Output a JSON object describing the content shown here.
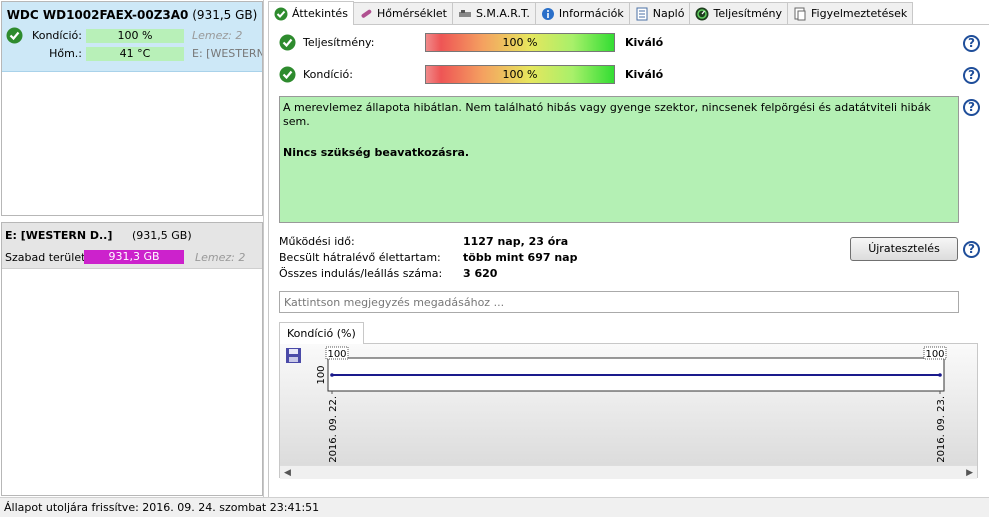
{
  "disk": {
    "model": "WDC WD1002FAEX-00Z3A0",
    "capacity": "(931,5 GB)",
    "condition_label": "Kondíció:",
    "condition_value": "100 %",
    "condition_extra": "Lemez: 2",
    "temp_label": "Hőm.:",
    "temp_value": "41 °C",
    "temp_extra": "E: [WESTERN"
  },
  "volume": {
    "name": "E: [WESTERN D..]",
    "size": "(931,5 GB)",
    "free_label": "Szabad terület",
    "free_value": "931,3 GB",
    "disk_label": "Lemez: 2"
  },
  "tabs": [
    {
      "label": "Áttekintés",
      "icon": "check-icon"
    },
    {
      "label": "Hőmérséklet",
      "icon": "thermometer-icon"
    },
    {
      "label": "S.M.A.R.T.",
      "icon": "smart-icon"
    },
    {
      "label": "Információk",
      "icon": "info-icon"
    },
    {
      "label": "Napló",
      "icon": "log-icon"
    },
    {
      "label": "Teljesítmény",
      "icon": "gauge-icon"
    },
    {
      "label": "Figyelmeztetések",
      "icon": "alerts-icon"
    }
  ],
  "metrics": [
    {
      "label": "Teljesítmény:",
      "bar": "100 %",
      "level": 1.0,
      "rating": "Kiváló"
    },
    {
      "label": "Kondíció:",
      "bar": "100 %",
      "level": 1.0,
      "rating": "Kiváló"
    }
  ],
  "status": {
    "message": "A merevlemez állapota hibátlan. Nem található hibás vagy gyenge szektor, nincsenek felpörgési és adatátviteli hibák sem.",
    "action": "Nincs szükség beavatkozásra."
  },
  "info": {
    "uptime_label": "Működési idő:",
    "uptime_value": "1127 nap, 23 óra",
    "remaining_label": "Becsült hátralévő élettartam:",
    "remaining_value": "több mint 697 nap",
    "starts_label": "Összes indulás/leállás száma:",
    "starts_value": "3 620"
  },
  "retest_label": "Újratesztelés",
  "note_placeholder": "Kattintson megjegyzés megadásához ...",
  "chart_tab": "Kondíció  (%)",
  "chart_data": {
    "type": "line",
    "x": [
      "2016. 09. 22.",
      "2016. 09. 23."
    ],
    "values": [
      100,
      100
    ],
    "point_labels": [
      "100",
      "100"
    ],
    "y_tick": "100",
    "color": "#1a1a8c"
  },
  "statusbar_text": "Állapot utoljára frissítve: 2016. 09. 24. szombat 23:41:51",
  "colors": {
    "good": "#b4f0b4",
    "volume_bar": "#cc22cc",
    "disk_header": "#cde8f7"
  }
}
